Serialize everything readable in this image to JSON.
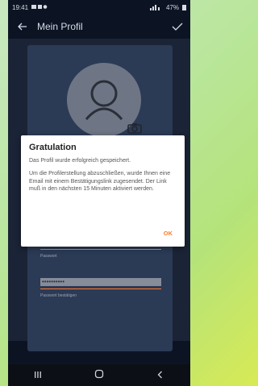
{
  "status_bar": {
    "time": "19:41",
    "right_text": "47%"
  },
  "app_bar": {
    "back_icon": "arrow-left-icon",
    "title": "Mein Profil",
    "check_icon": "check-icon"
  },
  "form": {
    "password_label": "Passwort",
    "password_confirm_value": "••••••••••",
    "password_confirm_label": "Passwort bestätigen"
  },
  "dialog": {
    "title": "Gratulation",
    "message1": "Das Profil wurde erfolgreich gespeichert.",
    "message2": "Um die Profilerstellung abzuschließen, wurde Ihnen eine Email mit einem Bestätigungslink zugesendet. Der Link muß in den nächsten 15 Minuten aktiviert werden.",
    "ok_label": "OK"
  },
  "nav_bar": {
    "recent_icon": "recent-apps-icon",
    "home_icon": "home-icon",
    "back_icon": "chevron-left-icon"
  },
  "colors": {
    "accent": "#ff7a2e",
    "dialog_bg": "#ffffff",
    "app_bg": "#0c1424"
  }
}
